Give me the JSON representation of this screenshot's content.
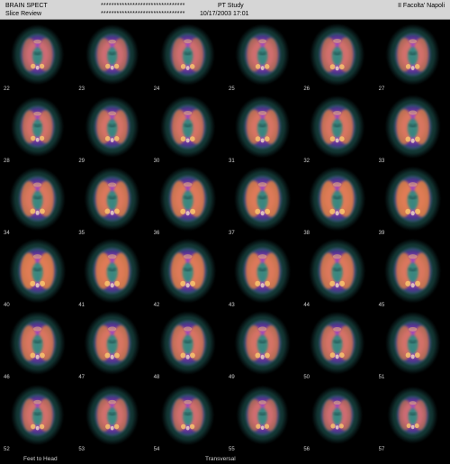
{
  "header": {
    "left_title": "BRAIN SPECT",
    "left_subtitle": "Slice Review",
    "masked_1": "********************************",
    "masked_2": "********************************",
    "study_title": "PT Study",
    "date_time": "10/17/2003 17:01",
    "institution": "II Facolta' Napoli"
  },
  "footer": {
    "left_label": "Feet to Head",
    "center_label": "Transversal"
  },
  "colors": {
    "header_bg": "#d6d6d6",
    "background": "#000000",
    "palette": [
      "#101a2a",
      "#1b4a4a",
      "#2e8a7f",
      "#5b2fa8",
      "#8b43d6",
      "#c04ad0",
      "#f08a3a",
      "#ffd070",
      "#fff4c8"
    ]
  },
  "slices": [
    {
      "num": "22",
      "size": 0.78
    },
    {
      "num": "23",
      "size": 0.78
    },
    {
      "num": "24",
      "size": 0.8
    },
    {
      "num": "25",
      "size": 0.8
    },
    {
      "num": "26",
      "size": 0.82
    },
    {
      "num": "27",
      "size": 0.8
    },
    {
      "num": "28",
      "size": 0.78
    },
    {
      "num": "29",
      "size": 0.8
    },
    {
      "num": "30",
      "size": 0.82
    },
    {
      "num": "31",
      "size": 0.82
    },
    {
      "num": "32",
      "size": 0.82
    },
    {
      "num": "33",
      "size": 0.84
    },
    {
      "num": "34",
      "size": 0.84
    },
    {
      "num": "35",
      "size": 0.84
    },
    {
      "num": "36",
      "size": 0.86
    },
    {
      "num": "37",
      "size": 0.86
    },
    {
      "num": "38",
      "size": 0.86
    },
    {
      "num": "39",
      "size": 0.86
    },
    {
      "num": "40",
      "size": 0.86
    },
    {
      "num": "41",
      "size": 0.86
    },
    {
      "num": "42",
      "size": 0.86
    },
    {
      "num": "43",
      "size": 0.86
    },
    {
      "num": "44",
      "size": 0.86
    },
    {
      "num": "45",
      "size": 0.86
    },
    {
      "num": "46",
      "size": 0.84
    },
    {
      "num": "47",
      "size": 0.84
    },
    {
      "num": "48",
      "size": 0.84
    },
    {
      "num": "49",
      "size": 0.84
    },
    {
      "num": "50",
      "size": 0.82
    },
    {
      "num": "51",
      "size": 0.82
    },
    {
      "num": "52",
      "size": 0.78
    },
    {
      "num": "53",
      "size": 0.78
    },
    {
      "num": "54",
      "size": 0.78
    },
    {
      "num": "55",
      "size": 0.76
    },
    {
      "num": "56",
      "size": 0.74
    },
    {
      "num": "57",
      "size": 0.72
    }
  ]
}
